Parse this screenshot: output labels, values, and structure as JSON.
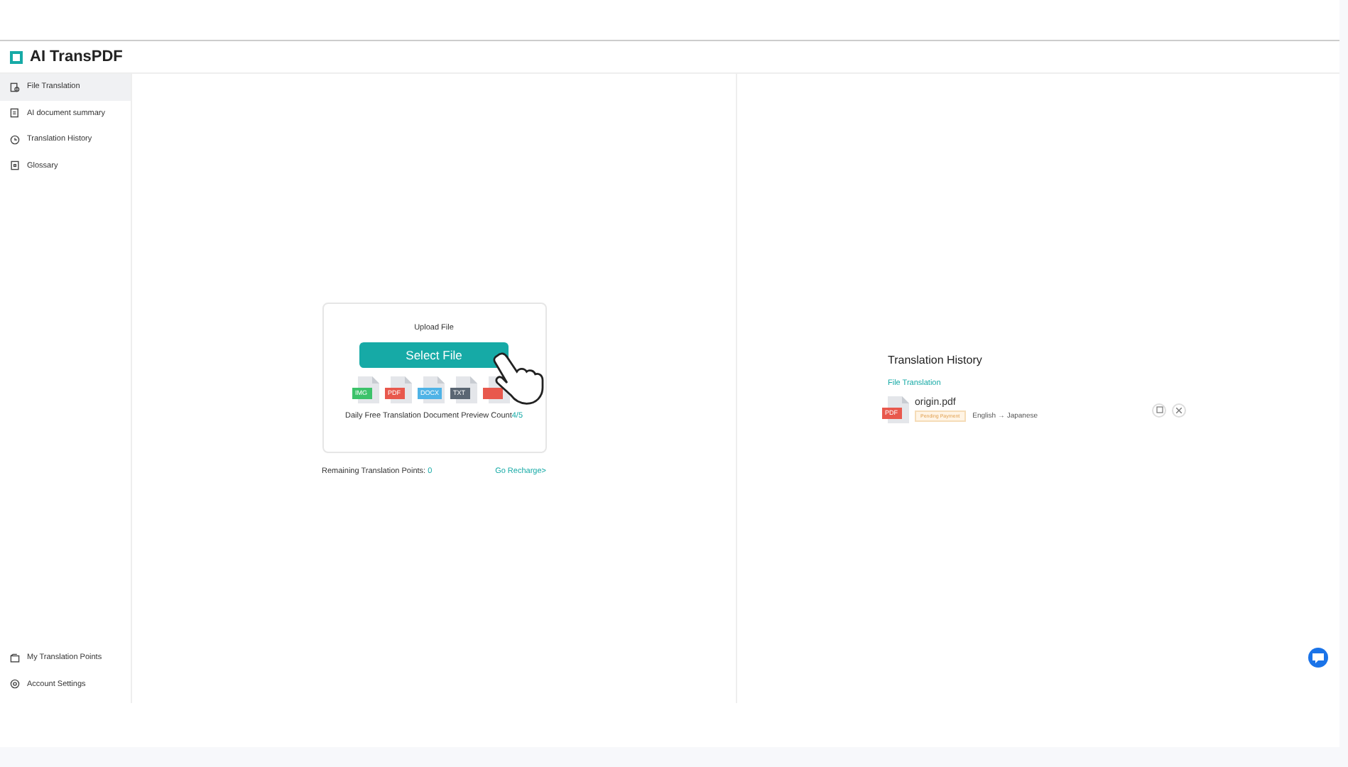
{
  "brand": "AI TransPDF",
  "sidebar": {
    "items": [
      {
        "label": "File Translation",
        "selected": true
      },
      {
        "label": "AI document summary",
        "selected": false
      },
      {
        "label": "Translation History",
        "selected": false
      },
      {
        "label": "Glossary",
        "selected": false
      }
    ],
    "bottom_items": [
      {
        "label": "My Translation Points"
      },
      {
        "label": "Account Settings"
      }
    ]
  },
  "upload": {
    "title": "Upload File",
    "button": "Select File",
    "file_types": [
      {
        "label": "IMG",
        "color": "#3cc26a"
      },
      {
        "label": "PDF",
        "color": "#e8584d"
      },
      {
        "label": "DOCX",
        "color": "#4fb3e6"
      },
      {
        "label": "TXT",
        "color": "#5a6673"
      },
      {
        "color": "#e8584d"
      }
    ],
    "preview_text": "Daily Free Translation Document Preview Count",
    "preview_count": "4/5"
  },
  "points": {
    "label": "Remaining Translation Points:",
    "value": "0",
    "recharge": "Go Recharge>"
  },
  "history": {
    "title": "Translation History",
    "section": "File Translation",
    "items": [
      {
        "name": "origin.pdf",
        "type": "PDF",
        "status": "Pending Payment",
        "languages": "English → Japanese"
      }
    ]
  }
}
